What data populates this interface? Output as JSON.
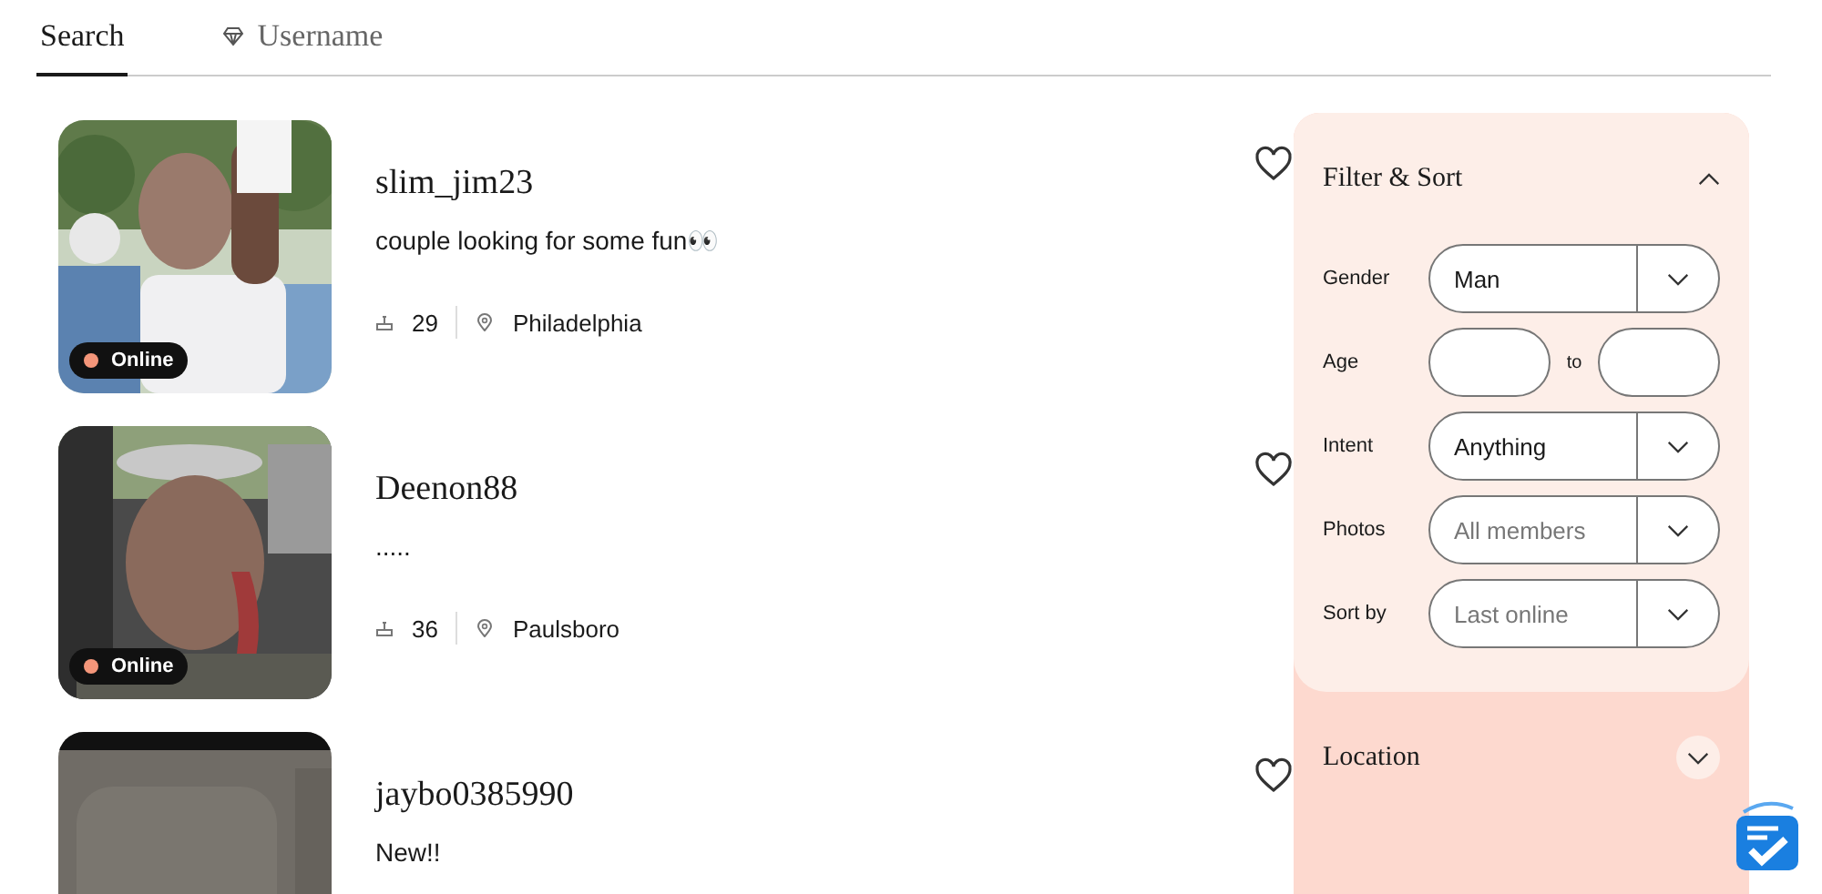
{
  "tabs": [
    {
      "label": "Search",
      "selected": true,
      "kind": "plain"
    },
    {
      "label": "Username",
      "selected": false,
      "kind": "gem"
    }
  ],
  "profiles": [
    {
      "username": "slim_jim23",
      "bio": "couple looking for some fun👀",
      "age": "29",
      "location": "Philadelphia",
      "status": "Online",
      "favorited": false
    },
    {
      "username": "Deenon88",
      "bio": ".....",
      "age": "36",
      "location": "Paulsboro",
      "status": "Online",
      "favorited": false
    },
    {
      "username": "jaybo0385990",
      "bio": "New!!",
      "favorited": false
    }
  ],
  "filter": {
    "title": "Filter & Sort",
    "expanded": true,
    "fields": [
      {
        "kind": "select",
        "label": "Gender",
        "value": "Man"
      },
      {
        "kind": "range",
        "label": "Age",
        "separator": "to"
      },
      {
        "kind": "select",
        "label": "Intent",
        "value": "Anything"
      },
      {
        "kind": "select",
        "label": "Photos",
        "placeholder": "All members"
      },
      {
        "kind": "select",
        "label": "Sort by",
        "placeholder": "Last online"
      }
    ]
  },
  "location": {
    "title": "Location",
    "expanded": false
  }
}
